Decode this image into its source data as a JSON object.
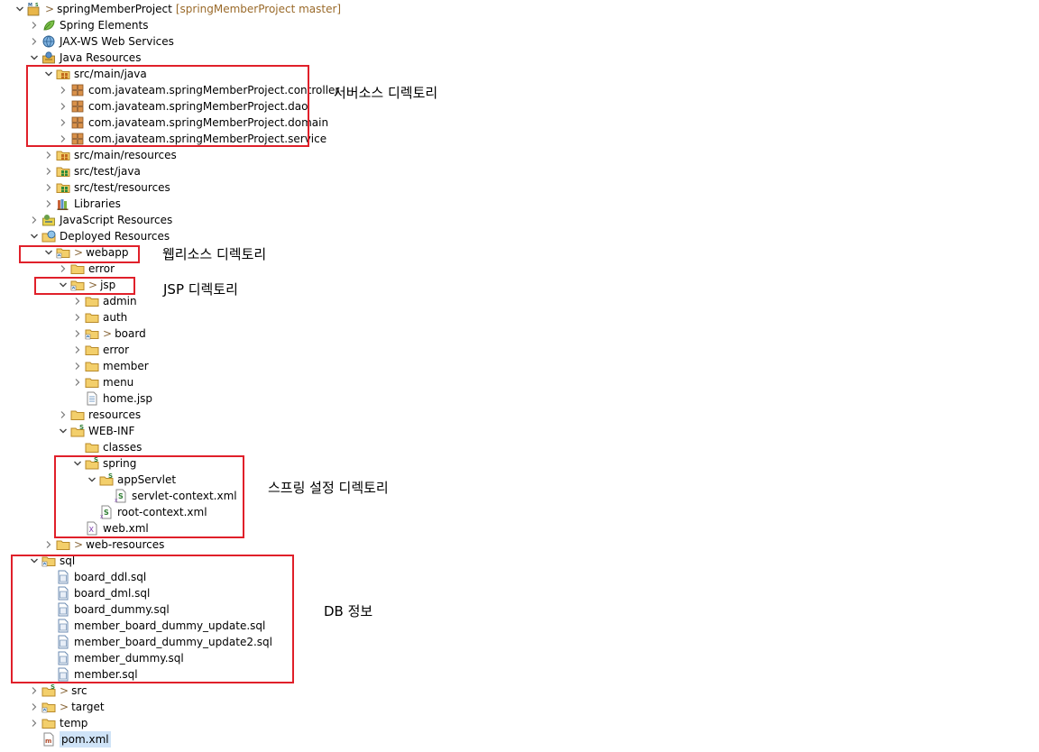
{
  "project": {
    "name": "springMemberProject",
    "repo": "[springMemberProject master]"
  },
  "tree": [
    {
      "depth": 0,
      "twisty": "open",
      "icon": "project",
      "dec": ">",
      "label": "springMemberProject",
      "sub": "[springMemberProject master]"
    },
    {
      "depth": 1,
      "twisty": "closed",
      "icon": "leaf",
      "label": "Spring Elements"
    },
    {
      "depth": 1,
      "twisty": "closed",
      "icon": "globe",
      "label": "JAX-WS Web Services"
    },
    {
      "depth": 1,
      "twisty": "open",
      "icon": "jres",
      "label": "Java Resources"
    },
    {
      "depth": 2,
      "twisty": "open",
      "icon": "srcfolder",
      "label": "src/main/java"
    },
    {
      "depth": 3,
      "twisty": "closed",
      "icon": "package",
      "label": "com.javateam.springMemberProject.controller"
    },
    {
      "depth": 3,
      "twisty": "closed",
      "icon": "package",
      "label": "com.javateam.springMemberProject.dao"
    },
    {
      "depth": 3,
      "twisty": "closed",
      "icon": "package",
      "label": "com.javateam.springMemberProject.domain"
    },
    {
      "depth": 3,
      "twisty": "closed",
      "icon": "package",
      "label": "com.javateam.springMemberProject.service"
    },
    {
      "depth": 2,
      "twisty": "closed",
      "icon": "srcfolder",
      "label": "src/main/resources"
    },
    {
      "depth": 2,
      "twisty": "closed",
      "icon": "srcfolder-green",
      "label": "src/test/java"
    },
    {
      "depth": 2,
      "twisty": "closed",
      "icon": "srcfolder-green",
      "label": "src/test/resources"
    },
    {
      "depth": 2,
      "twisty": "closed",
      "icon": "library",
      "label": "Libraries"
    },
    {
      "depth": 1,
      "twisty": "closed",
      "icon": "jsres",
      "label": "JavaScript Resources"
    },
    {
      "depth": 1,
      "twisty": "open",
      "icon": "deployed",
      "label": "Deployed Resources"
    },
    {
      "depth": 2,
      "twisty": "open",
      "icon": "folder-mod",
      "dec": ">",
      "label": "webapp"
    },
    {
      "depth": 3,
      "twisty": "closed",
      "icon": "folder",
      "label": "error"
    },
    {
      "depth": 3,
      "twisty": "open",
      "icon": "folder-mod",
      "dec": ">",
      "label": "jsp"
    },
    {
      "depth": 4,
      "twisty": "closed",
      "icon": "folder",
      "label": "admin"
    },
    {
      "depth": 4,
      "twisty": "closed",
      "icon": "folder",
      "label": "auth"
    },
    {
      "depth": 4,
      "twisty": "closed",
      "icon": "folder-mod",
      "dec": ">",
      "label": "board"
    },
    {
      "depth": 4,
      "twisty": "closed",
      "icon": "folder",
      "label": "error"
    },
    {
      "depth": 4,
      "twisty": "closed",
      "icon": "folder",
      "label": "member"
    },
    {
      "depth": 4,
      "twisty": "closed",
      "icon": "folder",
      "label": "menu"
    },
    {
      "depth": 4,
      "twisty": "none",
      "icon": "jspfile",
      "label": "home.jsp"
    },
    {
      "depth": 3,
      "twisty": "closed",
      "icon": "folder",
      "label": "resources"
    },
    {
      "depth": 3,
      "twisty": "open",
      "icon": "folder-spring",
      "label": "WEB-INF"
    },
    {
      "depth": 4,
      "twisty": "none",
      "icon": "folder",
      "label": "classes"
    },
    {
      "depth": 4,
      "twisty": "open",
      "icon": "folder-spring",
      "label": "spring"
    },
    {
      "depth": 5,
      "twisty": "open",
      "icon": "folder-spring",
      "label": "appServlet"
    },
    {
      "depth": 6,
      "twisty": "none",
      "icon": "springxml",
      "label": "servlet-context.xml"
    },
    {
      "depth": 5,
      "twisty": "none",
      "icon": "springxml",
      "label": "root-context.xml"
    },
    {
      "depth": 4,
      "twisty": "none",
      "icon": "xmlfile",
      "label": "web.xml"
    },
    {
      "depth": 2,
      "twisty": "closed",
      "icon": "folder",
      "dec": ">",
      "label": "web-resources"
    },
    {
      "depth": 1,
      "twisty": "open",
      "icon": "folder-mod",
      "label": "sql"
    },
    {
      "depth": 2,
      "twisty": "none",
      "icon": "sqlfile",
      "label": "board_ddl.sql"
    },
    {
      "depth": 2,
      "twisty": "none",
      "icon": "sqlfile",
      "label": "board_dml.sql"
    },
    {
      "depth": 2,
      "twisty": "none",
      "icon": "sqlfile",
      "label": "board_dummy.sql"
    },
    {
      "depth": 2,
      "twisty": "none",
      "icon": "sqlfile",
      "label": "member_board_dummy_update.sql"
    },
    {
      "depth": 2,
      "twisty": "none",
      "icon": "sqlfile",
      "label": "member_board_dummy_update2.sql"
    },
    {
      "depth": 2,
      "twisty": "none",
      "icon": "sqlfile",
      "label": "member_dummy.sql"
    },
    {
      "depth": 2,
      "twisty": "none",
      "icon": "sqlfile",
      "label": "member.sql"
    },
    {
      "depth": 1,
      "twisty": "closed",
      "icon": "folder-spring",
      "dec": ">",
      "label": "src"
    },
    {
      "depth": 1,
      "twisty": "closed",
      "icon": "folder-mod",
      "dec": ">",
      "label": "target"
    },
    {
      "depth": 1,
      "twisty": "closed",
      "icon": "folder",
      "label": "temp"
    },
    {
      "depth": 1,
      "twisty": "none",
      "icon": "pomfile",
      "label": "pom.xml",
      "selected": true
    }
  ],
  "annotations": [
    {
      "label": "서버소스 디렉토리"
    },
    {
      "label": "웹리소스 디렉토리"
    },
    {
      "label": "JSP 디렉토리"
    },
    {
      "label": "스프링 설정 디렉토리"
    },
    {
      "label": "DB 정보"
    }
  ],
  "colors": {
    "highlight_box": "#e0202a",
    "folder": "#e8b64a",
    "selection": "#cfe3f7",
    "decorator": "#8b6a3d"
  }
}
